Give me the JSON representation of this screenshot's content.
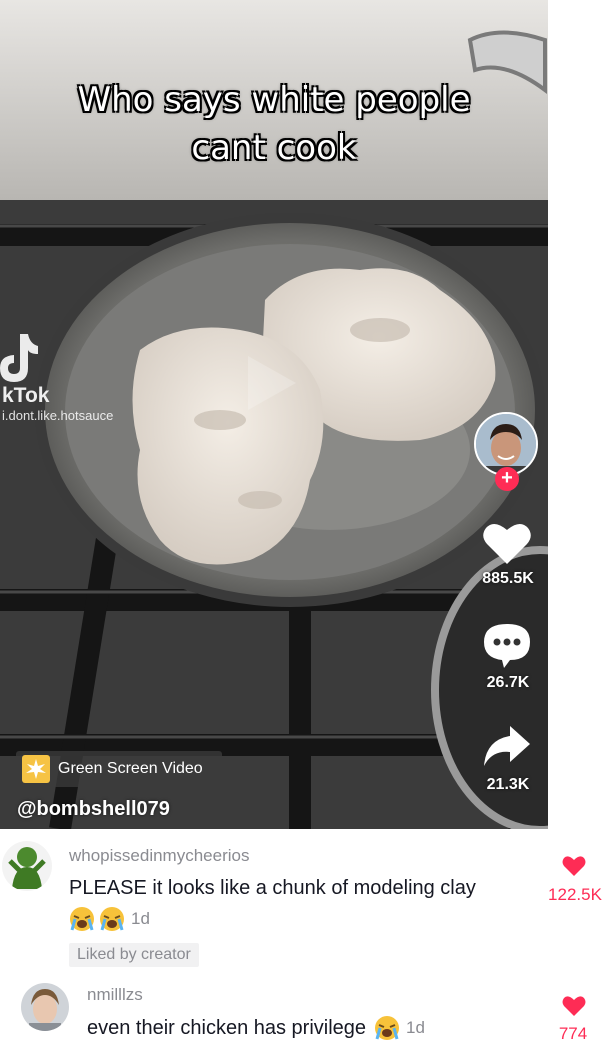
{
  "video": {
    "caption_lines": [
      "Who says white people",
      "cant cook"
    ],
    "watermark": {
      "brand": "kTok",
      "user": "i.dont.like.hotsauce"
    },
    "effect_label": "Green Screen Video",
    "author": "@bombshell079",
    "likes": "885.5K",
    "comments": "26.7K",
    "shares": "21.3K"
  },
  "comments": [
    {
      "user": "whopissedinmycheerios",
      "text": "PLEASE it looks like a chunk of modeling clay",
      "emojis": [
        "loudly-crying-face",
        "loudly-crying-face"
      ],
      "time": "1d",
      "badge": "Liked by creator",
      "likes": "122.5K"
    },
    {
      "user": "nmilllzs",
      "text": "even their chicken has privilege",
      "emojis": [
        "loudly-crying-face"
      ],
      "time": "1d",
      "likes": "774"
    }
  ],
  "colors": {
    "accent": "#fe2c55",
    "muted": "#8a8b91",
    "text": "#161823"
  }
}
